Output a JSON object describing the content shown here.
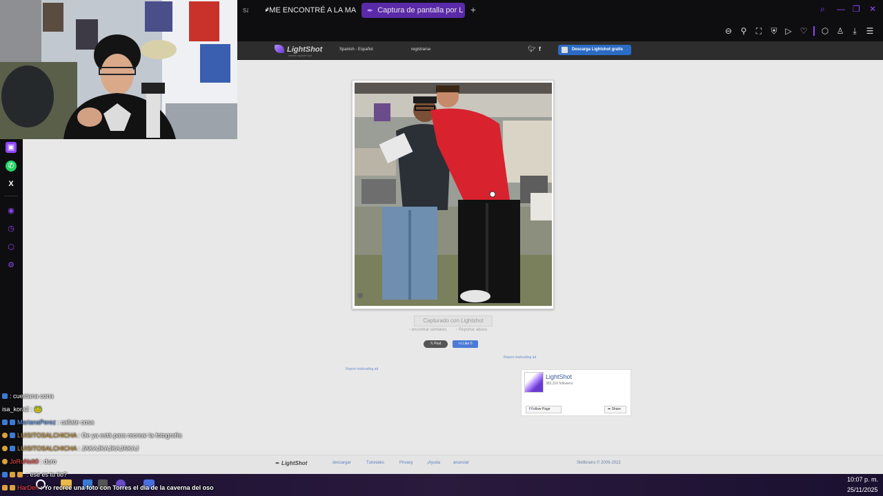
{
  "browser": {
    "tabs": [
      {
        "label": "sa",
        "active": false
      },
      {
        "label": "*ME ENCONTRÉ A LA MA",
        "active": false,
        "icon": "youtube-icon"
      },
      {
        "label": "Captura de pantalla por L",
        "active": true,
        "icon": "feather-icon"
      }
    ],
    "new_tab": "+",
    "toolbar_icons": [
      "zoom-icon",
      "pin-icon",
      "screenshot-icon",
      "shield-icon",
      "play-icon",
      "heart-icon",
      "extension-icon",
      "profile-icon",
      "download-icon",
      "menu-icon"
    ]
  },
  "lightshot": {
    "logo": "LightShot",
    "logo_sub": "screen capture tool",
    "language": "Spanish - Español",
    "register": "registrarse",
    "download_button": "Descarga Lightshot gratis",
    "caption": "Capturado con Lightshot",
    "find_similar": "encontrar similares",
    "report_abuse": "Reportar abuso",
    "post_button": "Post",
    "like_button": "Like 0",
    "report_ad_1": "Report misleading ad",
    "report_ad_2": "Report misleading ad",
    "fb_page_name": "LightShot",
    "fb_followers": "383,316 followers",
    "fb_follow": "Follow Page",
    "fb_share": "Share",
    "footer_logo": "LightShot",
    "footer_links": [
      "descargar",
      "Tutoriales",
      "Privacy",
      "¡Ayuda",
      "anunciar"
    ],
    "footer_copyright": "Skillbrains © 2009-2022"
  },
  "chat": [
    {
      "user": "",
      "message": ": cuestana cona"
    },
    {
      "user": "isa_kora2",
      "message": ":"
    },
    {
      "user": "MarianaPerez",
      "message": ": callate cosa"
    },
    {
      "user": "LUISITOSALCHICHA",
      "message": ": Oe ya está para recrear la fotografía"
    },
    {
      "user": "LUISITOSALCHICHA",
      "message": ": JAKAJKAJKAJAKAJ"
    },
    {
      "user": "JoRuNsIt0",
      "message": ": duro"
    },
    {
      "user": "",
      "message": ": ese es tu tio?"
    },
    {
      "user": "HarDen",
      "message": ": Yo recree una foto con Torres el dia de la caverna del oso"
    }
  ],
  "taskbar": {
    "time": "10:07 p. m.",
    "date": "25/11/2025"
  }
}
